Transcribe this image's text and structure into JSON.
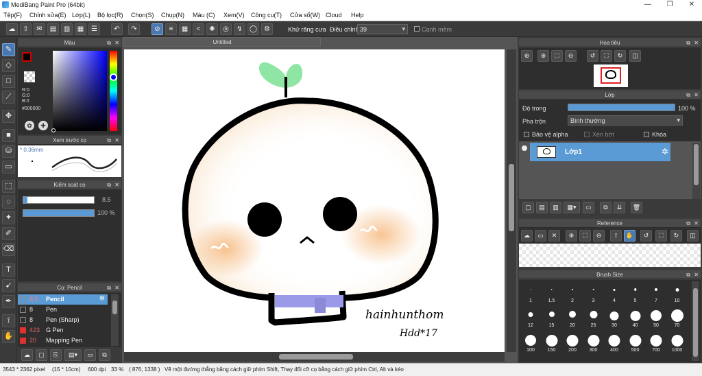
{
  "window": {
    "title": "MediBang Paint Pro (64bit)",
    "minimize": "—",
    "maximize": "❐",
    "close": "✕"
  },
  "menu": [
    "Tệp(F)",
    "Chỉnh sửa(E)",
    "Lớp(L)",
    "Bộ lọc(R)",
    "Chọn(S)",
    "Chụp(N)",
    "Màu (C)",
    "Xem(V)",
    "Công cụ(T)",
    "Cửa sổ(W)",
    "Cloud",
    "Help"
  ],
  "toolbar": {
    "antialias_label": "Khử răng cưa",
    "correction_label": "Điều chỉnh",
    "correction_value": "39",
    "sharp_label": "Cạnh mềm"
  },
  "color_panel": {
    "title": "Màu",
    "r": "R:0",
    "g": "G:0",
    "b": "B:0",
    "hex": "#000000"
  },
  "brush_preview": {
    "title": "Xem trước cọ",
    "size": "0.36mm"
  },
  "brush_control": {
    "title": "Kiểm soát cọ",
    "size_value": "8.5",
    "opacity_value": "100 %",
    "size_fraction": 0.06,
    "opacity_fraction": 1.0
  },
  "brush_list": {
    "title": "Cọ: Pencil",
    "items": [
      {
        "size": "8.5",
        "name": "Pencil",
        "color": "#2a2a2a",
        "selected": true
      },
      {
        "size": "8",
        "name": "Pen",
        "color": "#2a2a2a",
        "selected": false
      },
      {
        "size": "8",
        "name": "Pen (Sharp)",
        "color": "#2a2a2a",
        "selected": false
      },
      {
        "size": "423",
        "name": "G Pen",
        "color": "#e03030",
        "selected": false
      },
      {
        "size": "20",
        "name": "Mapping Pen",
        "color": "#e03030",
        "selected": false
      }
    ]
  },
  "canvas": {
    "tab_title": "Untitled",
    "signature_line1": "hainhunthom",
    "signature_line2": "Hdd*17"
  },
  "navigator": {
    "title": "Hoa tiêu"
  },
  "layer_panel": {
    "title": "Lớp",
    "opacity_label": "Độ trong",
    "opacity_value": "100 %",
    "opacity_fraction": 1.0,
    "blend_label": "Pha trộn",
    "blend_value": "Bình thường",
    "protect_alpha": "Bảo vệ alpha",
    "clipping": "Xén bớt",
    "lock": "Khóa",
    "layer_name": "Lớp1"
  },
  "reference_panel": {
    "title": "Reference"
  },
  "brush_size_panel": {
    "title": "Brush Size",
    "sizes": [
      "1",
      "1.5",
      "2",
      "3",
      "4",
      "5",
      "7",
      "10",
      "12",
      "15",
      "20",
      "25",
      "30",
      "40",
      "50",
      "70",
      "100",
      "150",
      "200",
      "300",
      "400",
      "500",
      "700",
      "1000"
    ]
  },
  "status": {
    "dimensions": "3543 * 2362 pixel",
    "physical": "(15 * 10cm)",
    "dpi": "600 dpi",
    "zoom": "33 %",
    "coords": "( 876, 1338 )",
    "hint": "Vẽ một đường thẳng bằng cách giữ phím Shift, Thay đổi cỡ cọ bằng cách giữ phím Ctrl, Alt và kéo"
  },
  "colors": {
    "accent": "#4a78b0",
    "selection": "#5b9bd5",
    "leaf": "#8fe6a4",
    "scarf": "#9a9ae8",
    "blush": "#f7c89a"
  }
}
